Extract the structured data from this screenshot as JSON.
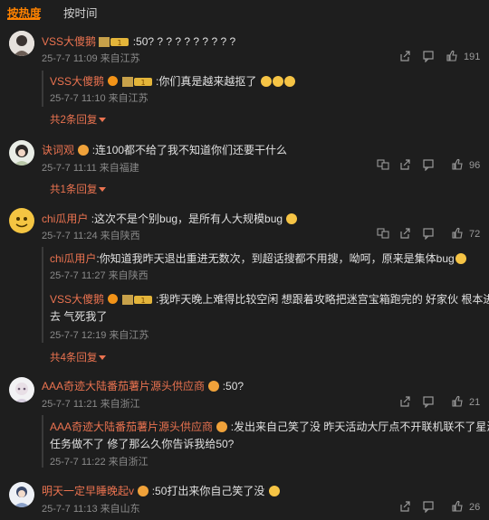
{
  "tabs": {
    "hot": "按热度",
    "time": "按时间"
  },
  "comments": [
    {
      "user": "VSS大傻鹅",
      "text": ":50? ? ? ? ? ? ? ? ? ?",
      "meta": "25-7-7 11:09 来自江苏",
      "likes": "191",
      "replies": [
        {
          "user": "VSS大傻鹅",
          "text": ":你们真是越来越抠了",
          "meta": "25-7-7 11:10 来自江苏"
        }
      ],
      "more": "共2条回复"
    },
    {
      "user": "诀词观",
      "text": ":连100都不给了我不知道你们还要干什么",
      "meta": "25-7-7 11:11 来自福建",
      "likes": "96",
      "more": "共1条回复"
    },
    {
      "user": "chi瓜用户",
      "text": ":这次不是个别bug，是所有人大规模bug",
      "meta": "25-7-7 11:24 来自陕西",
      "likes": "72",
      "replies": [
        {
          "user": "chi瓜用户",
          "text": ":你知道我昨天退出重进无数次，到超话搜都不用搜，呦呵，原来是集体bug",
          "meta": "25-7-7 11:27 来自陕西"
        },
        {
          "user": "VSS大傻鹅",
          "text": ":我昨天晚上难得比较空闲 想跟着攻略把迷宫宝箱跑完的 好家伙 根本进不",
          "text2": "去 气死我了",
          "meta": "25-7-7 12:19 来自江苏"
        }
      ],
      "more": "共4条回复"
    },
    {
      "user": "AAA奇迹大陆番茄薯片源头供应商",
      "text": ":50?",
      "meta": "25-7-7 11:21 来自浙江",
      "likes": "21",
      "replies": [
        {
          "user": "AAA奇迹大陆番茄薯片源头供应商",
          "text": ":发出来自己笑了没 昨天活动大厅点不开联机联不了星海",
          "text2": "任务做不了 修了那么久你告诉我给50?",
          "meta": "25-7-7 11:22 来自浙江"
        }
      ]
    },
    {
      "user": "明天一定早睡晚起v",
      "text": ":50打出来你自己笑了没",
      "meta": "25-7-7 11:13 来自山东",
      "likes": "26"
    }
  ],
  "colors": {
    "accent": "#ff8200",
    "username": "#eb7350",
    "background": "#1e1e1e"
  }
}
